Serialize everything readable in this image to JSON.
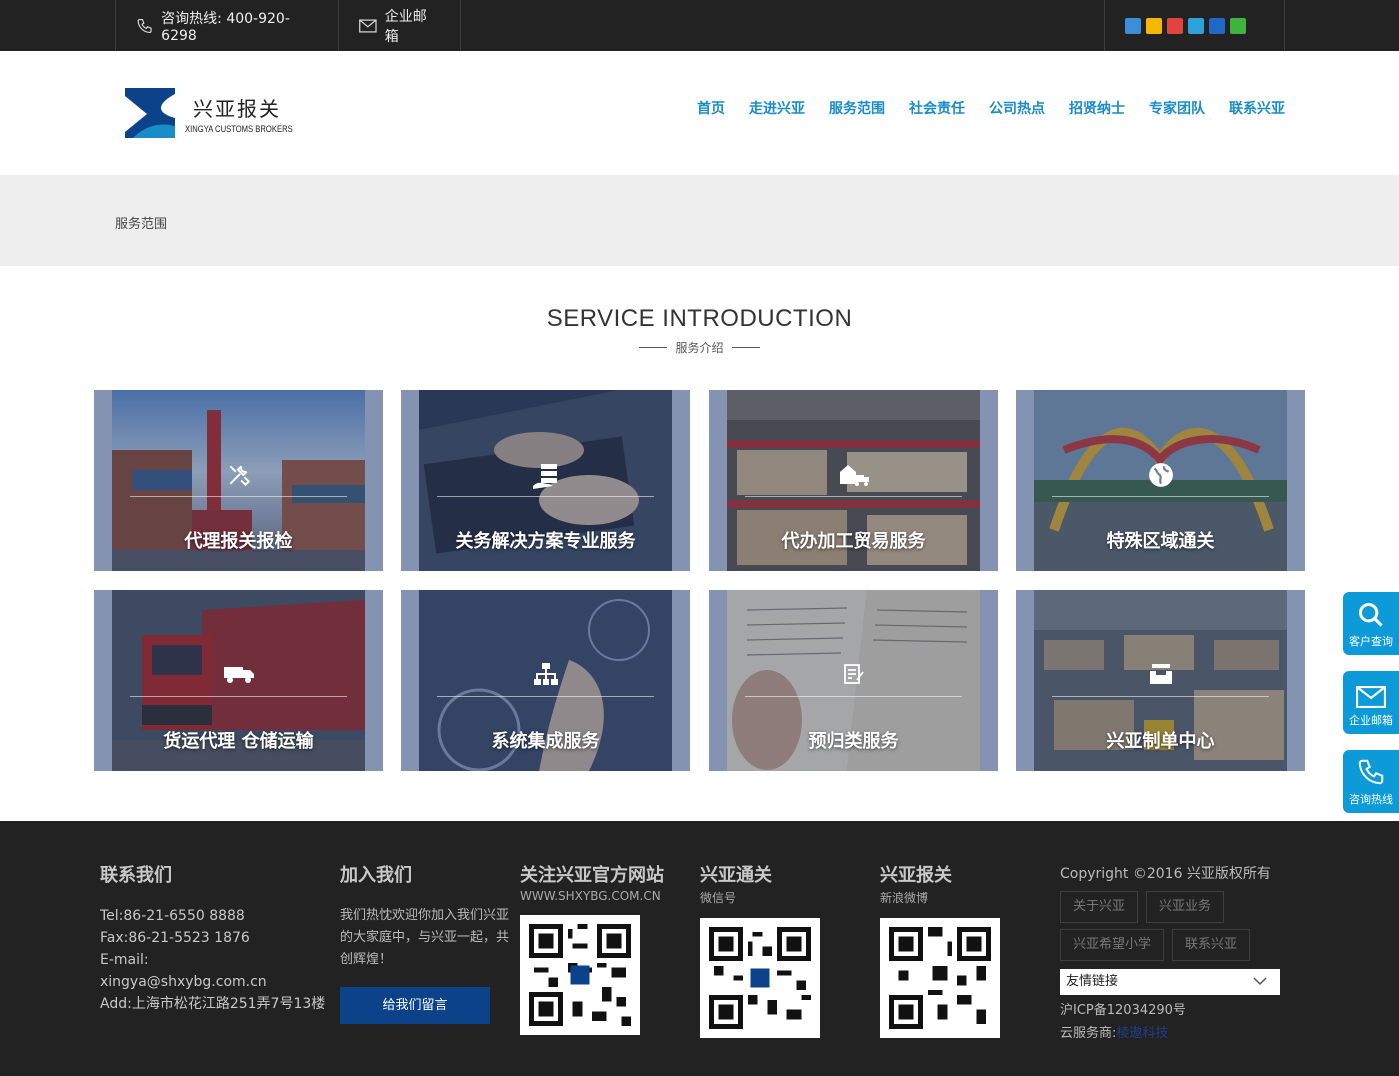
{
  "topbar": {
    "phone_label": "咨询热线: 400-920-6298",
    "mail_label": "企业邮箱",
    "share_icons": [
      "plus-share-icon",
      "qzone-icon",
      "weibo-icon",
      "tencent-weibo-icon",
      "renren-icon",
      "wechat-icon"
    ]
  },
  "header": {
    "logo_cn": "兴亚报关",
    "logo_en": "XINGYA CUSTOMS BROKERS",
    "nav": [
      "首页",
      "走进兴亚",
      "服务范围",
      "社会责任",
      "公司热点",
      "招贤纳士",
      "专家团队",
      "联系兴亚"
    ]
  },
  "breadcrumb": "服务范围",
  "section": {
    "title": "SERVICE INTRODUCTION",
    "subtitle": "服务介绍"
  },
  "services": [
    {
      "label": "代理报关报检",
      "icon": "tools-icon"
    },
    {
      "label": "关务解决方案专业服务",
      "icon": "server-hand-icon"
    },
    {
      "label": "代办加工贸易服务",
      "icon": "warehouse-truck-icon"
    },
    {
      "label": "特殊区域通关",
      "icon": "globe-icon"
    },
    {
      "label": "货运代理 仓储运输",
      "icon": "truck-icon"
    },
    {
      "label": "系统集成服务",
      "icon": "sitemap-icon"
    },
    {
      "label": "预归类服务",
      "icon": "edit-list-icon"
    },
    {
      "label": "兴亚制单中心",
      "icon": "inbox-icon"
    }
  ],
  "side": {
    "query": "客户查询",
    "mail": "企业邮箱",
    "hotline": "咨询热线"
  },
  "footer": {
    "contact": {
      "title": "联系我们",
      "tel": "Tel:86-21-6550 8888",
      "fax": "Fax:86-21-5523 1876",
      "email_label": "E-mail:",
      "email": "xingya@shxybg.com.cn",
      "add": "Add:上海市松花江路251弄7号13楼"
    },
    "join": {
      "title": "加入我们",
      "text": "我们热忱欢迎你加入我们兴亚的大家庭中，与兴亚一起，共创辉煌！",
      "button": "给我们留言"
    },
    "official": {
      "title": "关注兴亚官方网站",
      "sub": "WWW.SHXYBG.COM.CN"
    },
    "wechat": {
      "title": "兴亚通关",
      "sub": "微信号"
    },
    "weibo": {
      "title": "兴亚报关",
      "sub": "新浪微博"
    },
    "copyright": "Copyright ©2016 兴亚版权所有",
    "links": [
      "关于兴亚",
      "兴亚业务",
      "兴亚希望小学",
      "联系兴亚"
    ],
    "friend_select": "友情链接",
    "icp": "沪ICP备12034290号",
    "service_label": "云服务商:",
    "service_link": "棱遨科技"
  },
  "colors": {
    "accent": "#1a8cc8",
    "side_blue": "#0c9ad9",
    "button_blue": "#0b4289",
    "dark": "#222222"
  }
}
